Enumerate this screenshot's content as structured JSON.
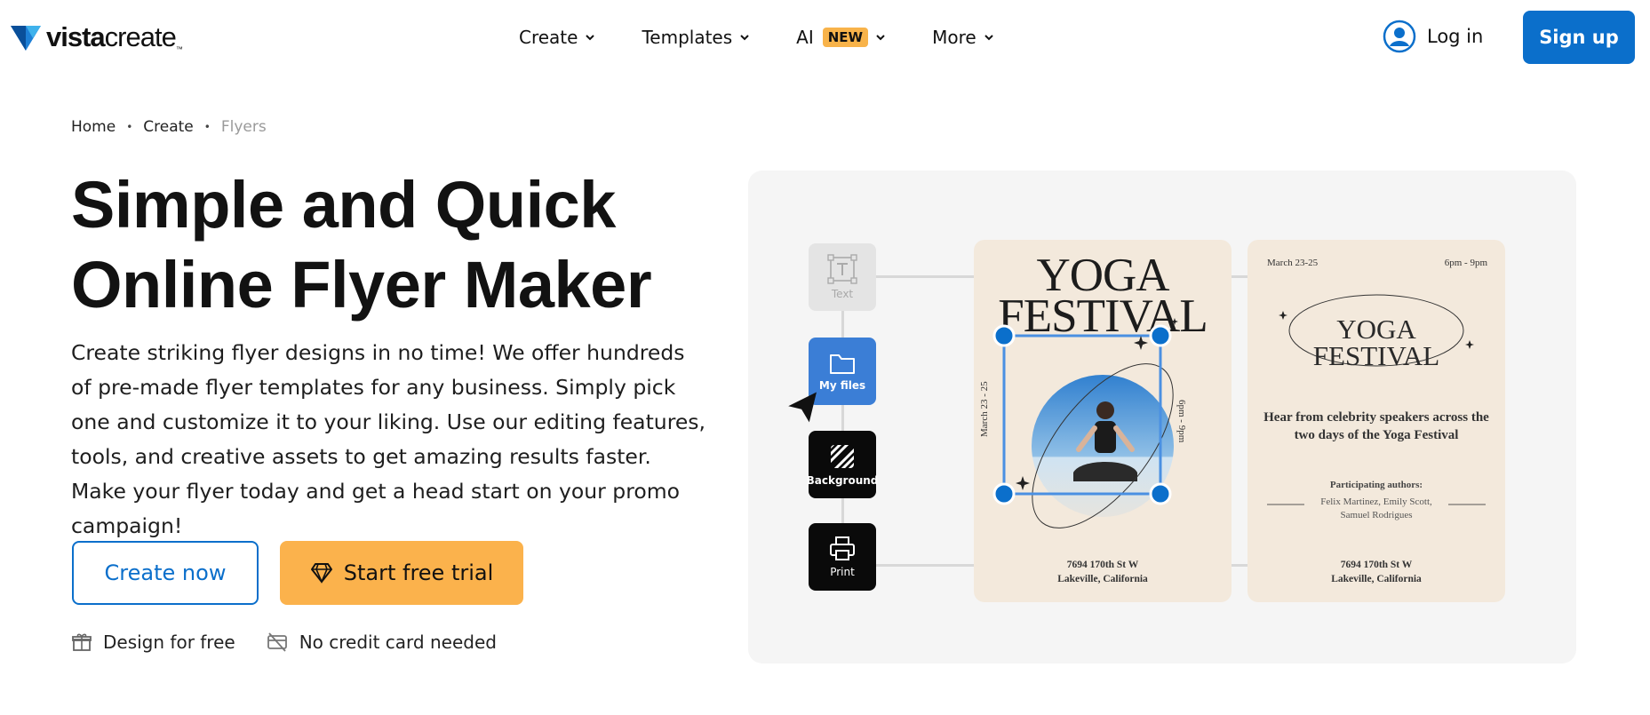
{
  "brand": {
    "name_bold": "vista",
    "name_rest": "create",
    "tm": "™",
    "accent": "#0b6fcb"
  },
  "nav": {
    "items": [
      {
        "label": "Create"
      },
      {
        "label": "Templates"
      },
      {
        "label": "AI",
        "badge": "NEW"
      },
      {
        "label": "More"
      }
    ],
    "login_label": "Log in",
    "signup_label": "Sign up"
  },
  "breadcrumb": [
    "Home",
    "Create",
    "Flyers"
  ],
  "hero": {
    "title_line1": "Simple and Quick",
    "title_line2": "Online Flyer Maker",
    "description": "Create striking flyer designs in no time! We offer hundreds of pre-made flyer templates for any business. Simply pick one and customize it to your liking. Use our editing features, tools, and creative assets to get amazing results faster. Make your flyer today and get a head start on your promo campaign!",
    "create_now_label": "Create now",
    "trial_label": "Start free trial",
    "trial_color": "#fbb24c",
    "perks": [
      "Design for free",
      "No credit card needed"
    ]
  },
  "illustration": {
    "tools": [
      {
        "label": "Text",
        "icon": "text-icon"
      },
      {
        "label": "My files",
        "icon": "folder-icon"
      },
      {
        "label": "Background",
        "icon": "background-icon"
      },
      {
        "label": "Print",
        "icon": "printer-icon"
      }
    ],
    "flyer1": {
      "title_line1": "YOGA",
      "title_line2": "FESTIVAL",
      "date": "March 23 - 25",
      "time": "6pm - 9pm",
      "address_line1": "7694 170th St W",
      "address_line2": "Lakeville, California"
    },
    "flyer2": {
      "date": "March 23-25",
      "time": "6pm - 9pm",
      "title_line1": "YOGA",
      "title_line2": "FESTIVAL",
      "heading": "Hear from celebrity speakers across the two days of the Yoga Festival",
      "authors_label": "Participating authors:",
      "authors_line1": "Felix Martinez, Emily Scott,",
      "authors_line2": "Samuel Rodrigues",
      "address_line1": "7694 170th St W",
      "address_line2": "Lakeville, California"
    }
  }
}
